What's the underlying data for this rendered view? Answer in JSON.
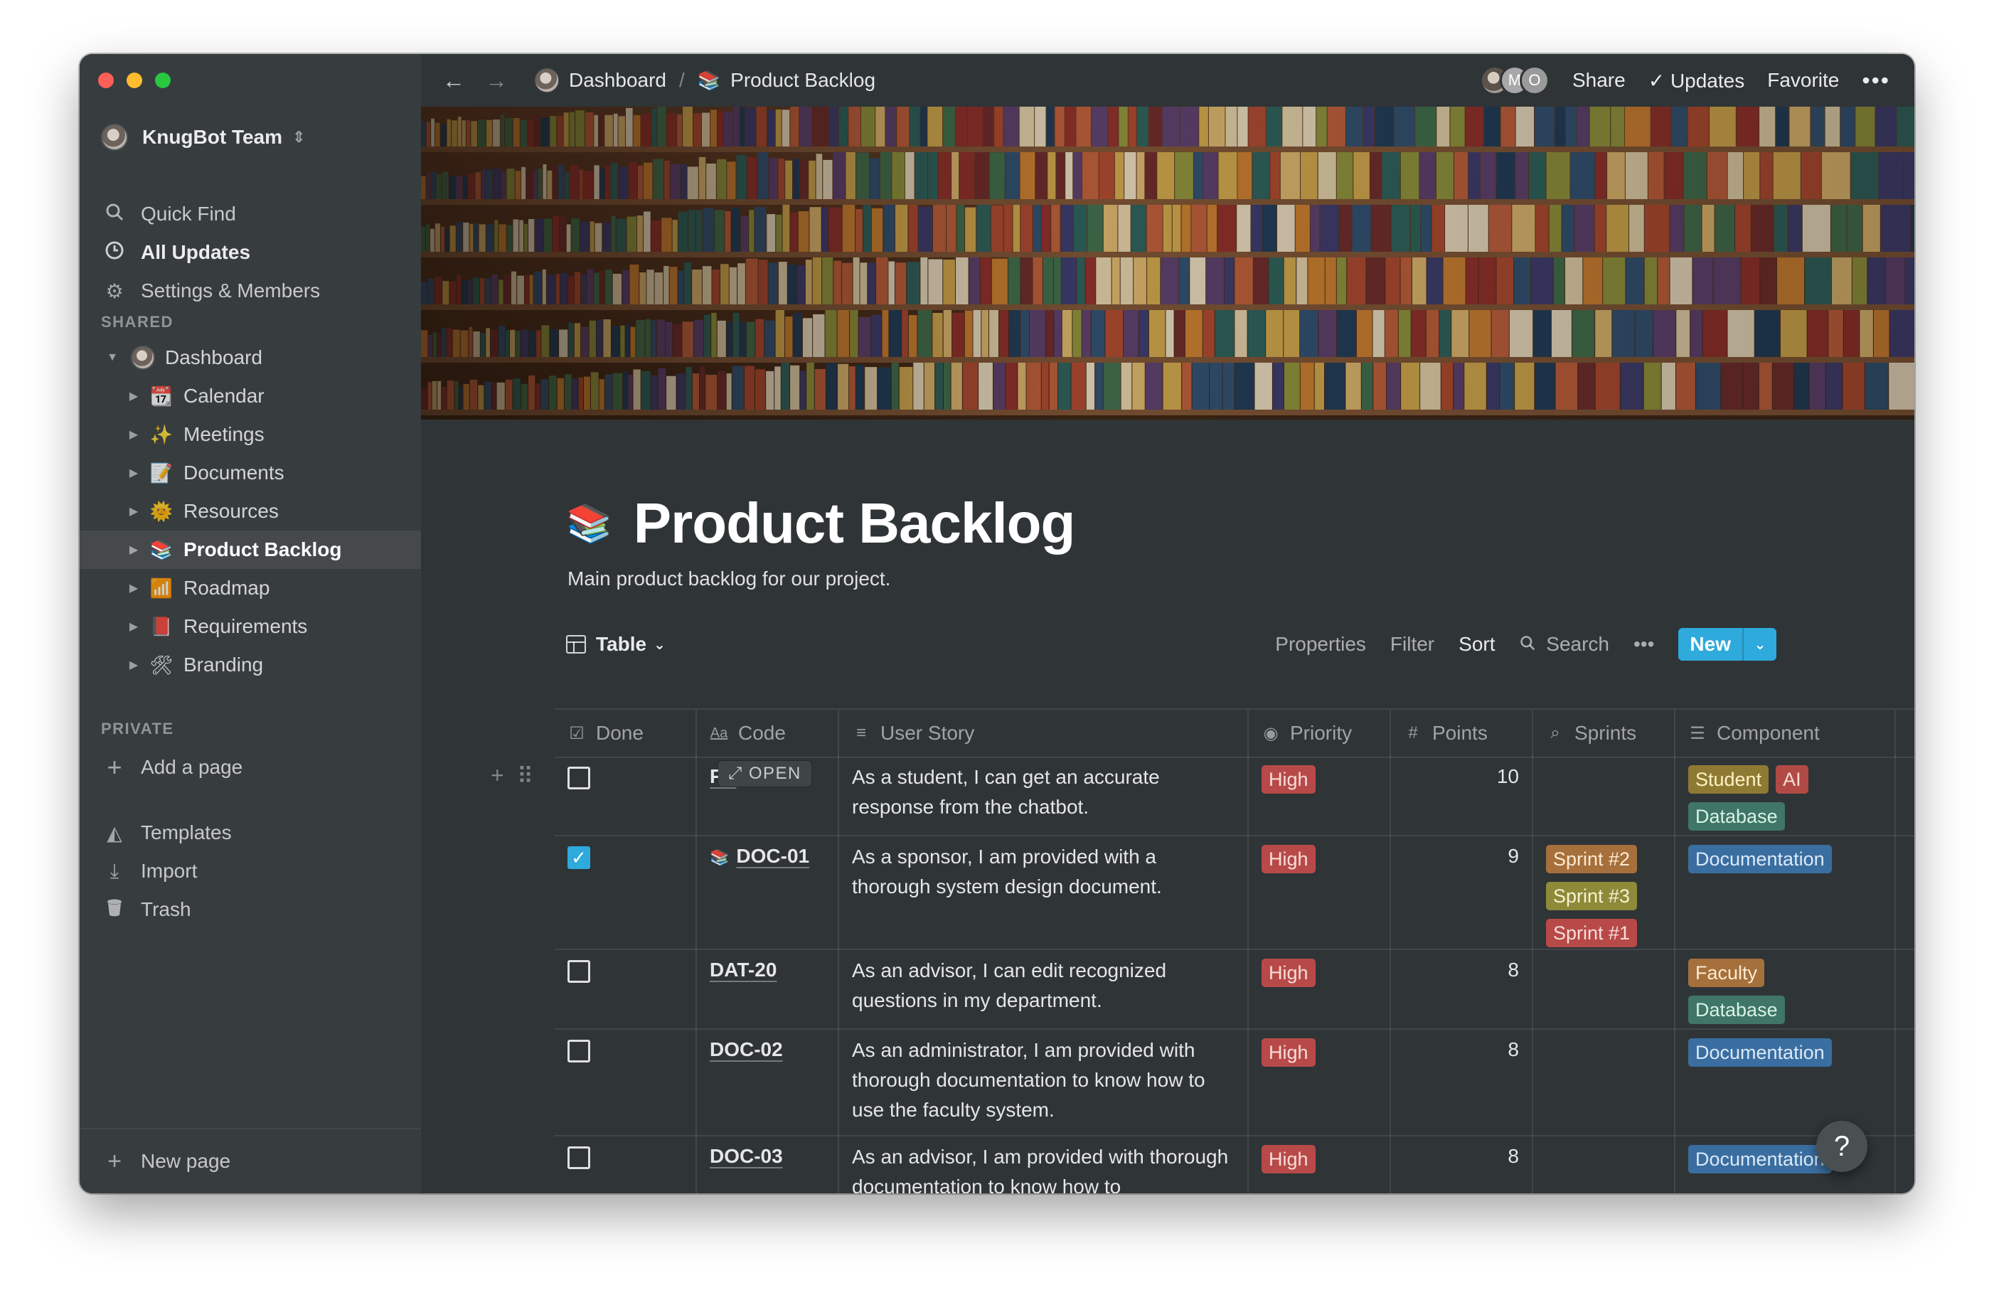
{
  "sidebar": {
    "team_name": "KnugBot Team",
    "top_items": [
      {
        "label": "Quick Find",
        "icon": "search-icon"
      },
      {
        "label": "All Updates",
        "icon": "clock-icon"
      },
      {
        "label": "Settings & Members",
        "icon": "gear-icon"
      }
    ],
    "shared_label": "SHARED",
    "dashboard_label": "Dashboard",
    "pages": [
      {
        "label": "Calendar",
        "icon": "calendar-icon"
      },
      {
        "label": "Meetings",
        "icon": "sparkle-icon"
      },
      {
        "label": "Documents",
        "icon": "memo-icon"
      },
      {
        "label": "Resources",
        "icon": "sun-icon"
      },
      {
        "label": "Product Backlog",
        "icon": "books-icon"
      },
      {
        "label": "Roadmap",
        "icon": "chart-icon"
      },
      {
        "label": "Requirements",
        "icon": "red-book-icon"
      },
      {
        "label": "Branding",
        "icon": "tools-icon"
      }
    ],
    "private_label": "PRIVATE",
    "add_page": "Add a page",
    "bottom_items": [
      {
        "label": "Templates",
        "icon": "shapes-icon"
      },
      {
        "label": "Import",
        "icon": "download-icon"
      },
      {
        "label": "Trash",
        "icon": "trash-icon"
      }
    ],
    "new_page": "New page"
  },
  "topbar": {
    "breadcrumb": [
      "Dashboard",
      "Product Backlog"
    ],
    "avatars": [
      "",
      "M",
      "O"
    ],
    "share": "Share",
    "updates": "Updates",
    "favorite": "Favorite",
    "more": "•••"
  },
  "page": {
    "title": "Product Backlog",
    "description": "Main product backlog for our project."
  },
  "view": {
    "name": "Table",
    "properties": "Properties",
    "filter": "Filter",
    "sort": "Sort",
    "search": "Search",
    "more": "•••",
    "new": "New"
  },
  "table": {
    "columns": [
      "Done",
      "Code",
      "User Story",
      "Priority",
      "Points",
      "Sprints",
      "Component"
    ],
    "open_label": "OPEN",
    "rows": [
      {
        "done": false,
        "code": "FN",
        "story": "As a student, I can get an accurate response from the chatbot.",
        "priority": "High",
        "points": "10",
        "sprints": [],
        "components": [
          "Student",
          "AI",
          "Database"
        ]
      },
      {
        "done": true,
        "code": "DOC-01",
        "story": "As a sponsor, I am provided with a thorough system design document.",
        "priority": "High",
        "points": "9",
        "sprints": [
          "Sprint #2",
          "Sprint #3",
          "Sprint #1"
        ],
        "components": [
          "Documentation"
        ]
      },
      {
        "done": false,
        "code": "DAT-20",
        "story": "As an advisor, I can edit recognized questions in my department.",
        "priority": "High",
        "points": "8",
        "sprints": [],
        "components": [
          "Faculty",
          "Database"
        ]
      },
      {
        "done": false,
        "code": "DOC-02",
        "story": "As an administrator, I am provided with thorough documentation to know how to use the faculty system.",
        "priority": "High",
        "points": "8",
        "sprints": [],
        "components": [
          "Documentation"
        ]
      },
      {
        "done": false,
        "code": "DOC-03",
        "story": "As an advisor, I am provided with thorough documentation to know how to",
        "priority": "High",
        "points": "8",
        "sprints": [],
        "components": [
          "Documentation"
        ]
      }
    ]
  },
  "help": "?"
}
